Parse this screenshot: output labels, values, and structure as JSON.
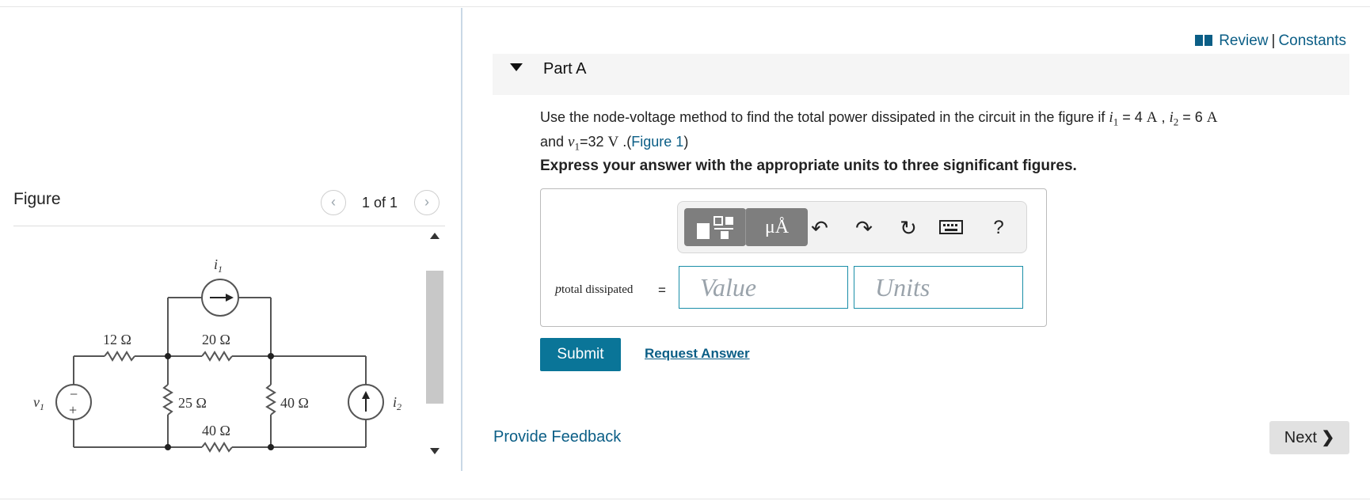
{
  "figure_panel": {
    "title": "Figure",
    "counter": "1 of 1",
    "prev_icon": "chevron-left-icon",
    "next_icon": "chevron-right-icon",
    "circuit_labels": {
      "v1": "v",
      "v1_sub": "1",
      "i1": "i",
      "i1_sub": "1",
      "i2": "i",
      "i2_sub": "2",
      "r12": "12 Ω",
      "r20": "20 Ω",
      "r25": "25 Ω",
      "r40a": "40 Ω",
      "r40b": "40 Ω",
      "plus": "+",
      "minus": "−"
    }
  },
  "header": {
    "review": "Review",
    "separator": "|",
    "constants": "Constants",
    "book_icon": "book-icon"
  },
  "part": {
    "title": "Part A",
    "expanded": true
  },
  "question": {
    "text_1": "Use the node-voltage method to find the total power dissipated in the circuit in the figure if ",
    "i1_var": "i",
    "i1_sub": "1",
    "i1_eq": " = 4 ",
    "i1_unit": "A",
    "sep": " , ",
    "i2_var": "i",
    "i2_sub": "2",
    "i2_eq": " = 6 ",
    "i2_unit": "A",
    "text_2": "and ",
    "v1_var": "v",
    "v1_sub": "1",
    "v1_eq": "=32 ",
    "v1_unit": "V",
    "text_3": " .(",
    "figure_link": "Figure 1",
    "text_4": ")",
    "instruction": "Express your answer with the appropriate units to three significant figures."
  },
  "answer": {
    "toolbar": {
      "templates_icon": "templates-icon",
      "units_label": "μÅ",
      "undo_icon": "undo-icon",
      "redo_icon": "redo-icon",
      "reset_icon": "reset-icon",
      "keyboard_icon": "keyboard-icon",
      "help_label": "?"
    },
    "variable": "p",
    "variable_sub": "total dissipated",
    "equals": "=",
    "value_placeholder": "Value",
    "units_placeholder": "Units"
  },
  "actions": {
    "submit": "Submit",
    "request_answer": "Request Answer",
    "provide_feedback": "Provide Feedback",
    "next": "Next"
  }
}
